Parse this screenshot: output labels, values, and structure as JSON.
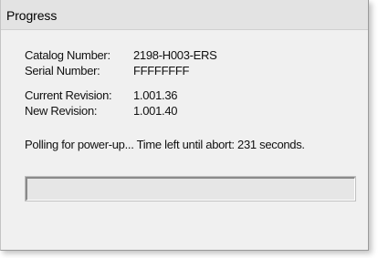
{
  "window": {
    "title": "Progress"
  },
  "info": {
    "catalog_label": "Catalog Number:",
    "catalog_value": "2198-H003-ERS",
    "serial_label": "Serial Number:",
    "serial_value": "FFFFFFFF",
    "current_rev_label": "Current Revision:",
    "current_rev_value": "1.001.36",
    "new_rev_label": "New Revision:",
    "new_rev_value": "1.001.40"
  },
  "status": {
    "message": "Polling for power-up... Time left until abort: 231 seconds."
  },
  "progress": {
    "fraction": 0
  }
}
